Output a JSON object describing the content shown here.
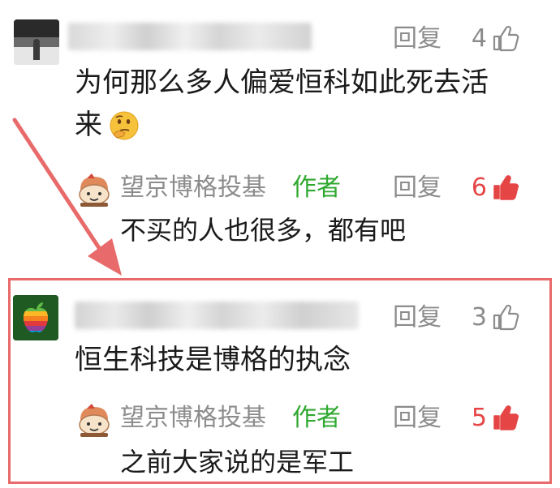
{
  "comments": [
    {
      "text_line1": "为何那么多人偏爱恒科如此死去活",
      "text_line2": "来",
      "reply_label": "回复",
      "likes": "4",
      "emoji_icon": "thinking-face-emoji",
      "author_reply": {
        "name": "望京博格投基",
        "tag": "作者",
        "text": "不买的人也很多，都有吧",
        "reply_label": "回复",
        "likes": "6"
      }
    },
    {
      "text": "恒生科技是博格的执念",
      "reply_label": "回复",
      "likes": "3",
      "author_reply": {
        "name": "望京博格投基",
        "tag": "作者",
        "text": "之前大家说的是军工",
        "reply_label": "回复",
        "likes": "5"
      }
    }
  ],
  "colors": {
    "liked": "#e54545",
    "muted": "#8c8c8c",
    "author_tag": "#2fa82f",
    "highlight": "#e86a6a",
    "arrow": "#e86a6a"
  }
}
